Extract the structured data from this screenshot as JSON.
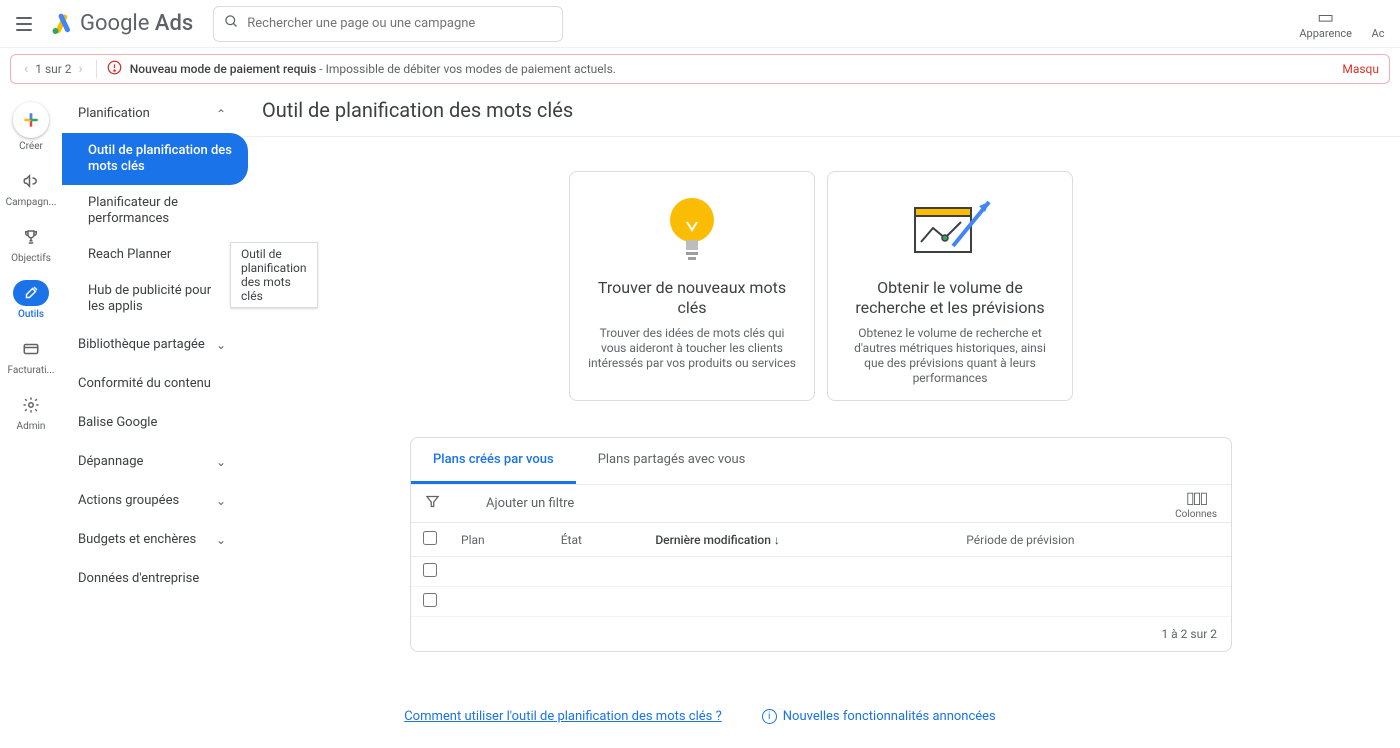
{
  "topbar": {
    "product": "Google",
    "product_sub": "Ads",
    "search_placeholder": "Rechercher une page ou une campagne",
    "right_items": [
      {
        "icon": "▭",
        "label": "Apparence"
      },
      {
        "icon": "",
        "label": "Ac"
      }
    ]
  },
  "alert": {
    "pager": "1 sur 2",
    "title": "Nouveau mode de paiement requis",
    "detail": " - Impossible de débiter vos modes de paiement actuels.",
    "hide": "Masqu"
  },
  "rail": [
    {
      "id": "create",
      "label": "Créer"
    },
    {
      "id": "campaigns",
      "label": "Campagn..."
    },
    {
      "id": "goals",
      "label": "Objectifs"
    },
    {
      "id": "tools",
      "label": "Outils",
      "active": true
    },
    {
      "id": "billing",
      "label": "Facturati..."
    },
    {
      "id": "admin",
      "label": "Admin"
    }
  ],
  "sidebar": {
    "sections": [
      {
        "label": "Planification",
        "expanded": true,
        "items": [
          {
            "label": "Outil de planification des mots clés",
            "active": true
          },
          {
            "label": "Planificateur de performances"
          },
          {
            "label": "Reach Planner"
          },
          {
            "label": "Hub de publicité pour les applis"
          }
        ]
      },
      {
        "label": "Bibliothèque partagée",
        "collapsible": true
      },
      {
        "label": "Conformité du contenu"
      },
      {
        "label": "Balise Google"
      },
      {
        "label": "Dépannage",
        "collapsible": true
      },
      {
        "label": "Actions groupées",
        "collapsible": true
      },
      {
        "label": "Budgets et enchères",
        "collapsible": true
      },
      {
        "label": "Données d'entreprise"
      }
    ],
    "tooltip": "Outil de planification des mots clés"
  },
  "page": {
    "title": "Outil de planification des mots clés"
  },
  "cards": [
    {
      "title": "Trouver de nouveaux mots clés",
      "desc": "Trouver des idées de mots clés qui vous aideront à toucher les clients intéressés par vos produits ou services"
    },
    {
      "title": "Obtenir le volume de recherche et les prévisions",
      "desc": "Obtenez le volume de recherche et d'autres métriques historiques, ainsi que des prévisions quant à leurs performances"
    }
  ],
  "plans": {
    "tabs": [
      {
        "label": "Plans créés par vous",
        "active": true
      },
      {
        "label": "Plans partagés avec vous"
      }
    ],
    "add_filter": "Ajouter un filtre",
    "columns_btn": "Colonnes",
    "headers": {
      "plan": "Plan",
      "state": "État",
      "modified": "Dernière modification",
      "forecast": "Période de prévision"
    },
    "rows": [
      {},
      {}
    ],
    "footer": "1 à 2 sur 2"
  },
  "footer": {
    "howto": "Comment utiliser l'outil de planification des mots clés ?",
    "announce": "Nouvelles fonctionnalités annoncées"
  }
}
